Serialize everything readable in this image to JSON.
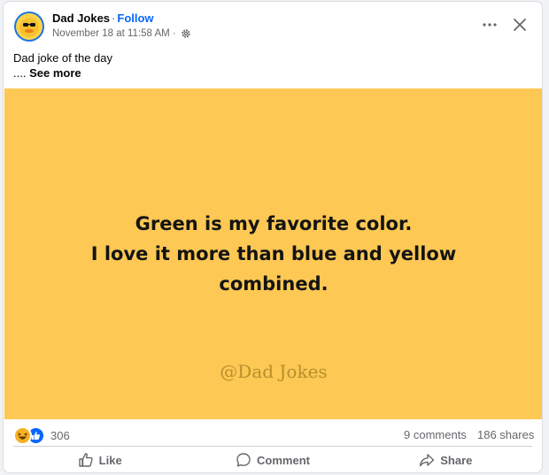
{
  "header": {
    "page_name": "Dad Jokes",
    "separator": "·",
    "follow_label": "Follow",
    "timestamp": "November 18 at 11:58 AM",
    "meta_separator": "·",
    "audience_icon": "gear-icon"
  },
  "post": {
    "text": "Dad joke of the day",
    "see_more_prefix": "....",
    "see_more_label": "See more"
  },
  "image": {
    "background": "#fdc853",
    "joke_lines": [
      "Green is my favorite color.",
      "I love it more than blue and yellow",
      "combined."
    ],
    "watermark": "@Dad Jokes"
  },
  "stats": {
    "reaction_icons": [
      "haha-reaction-icon",
      "like-reaction-icon"
    ],
    "reaction_count": "306",
    "comments": "9 comments",
    "shares": "186 shares"
  },
  "actions": {
    "like_label": "Like",
    "comment_label": "Comment",
    "share_label": "Share"
  },
  "colors": {
    "accent": "#0866ff",
    "secondary_text": "#65676b",
    "image_background": "#fdc853"
  }
}
